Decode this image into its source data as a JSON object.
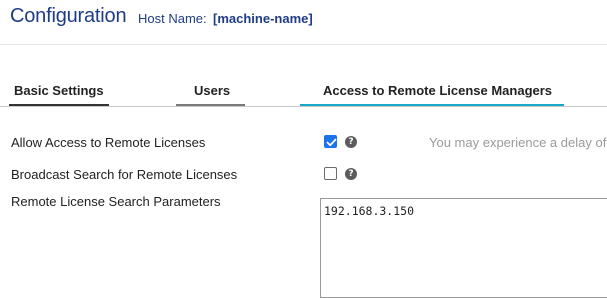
{
  "header": {
    "title": "Configuration",
    "host_label": "Host Name:",
    "host_value": "[machine-name]"
  },
  "tabs": [
    {
      "label": "Basic Settings",
      "active": false
    },
    {
      "label": "Users",
      "active": false
    },
    {
      "label": "Access to Remote License Managers",
      "active": true
    }
  ],
  "settings": {
    "allow_access": {
      "label": "Allow Access to Remote Licenses",
      "checked": true,
      "note": "You may experience a delay of"
    },
    "broadcast_search": {
      "label": "Broadcast Search for Remote Licenses",
      "checked": false
    },
    "search_params": {
      "label": "Remote License Search Parameters",
      "value": "192.168.3.150"
    }
  },
  "icons": {
    "help": "question-circle-icon",
    "check": "checkmark-icon"
  },
  "colors": {
    "title": "#1f3c86",
    "active_tab_underline": "#19a7c9",
    "checkbox_checked": "#1a73e8"
  }
}
